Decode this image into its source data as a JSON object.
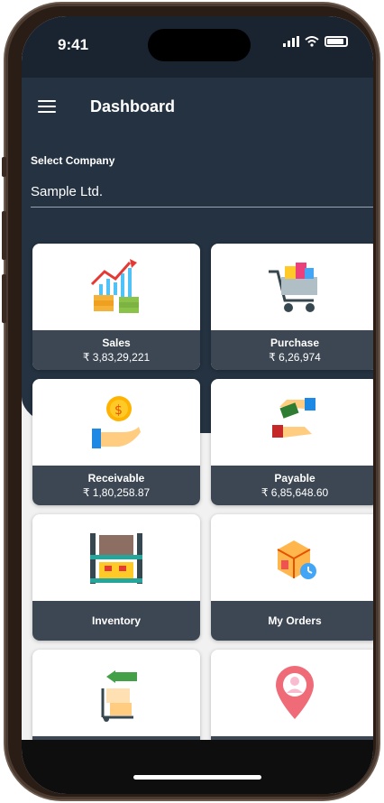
{
  "status": {
    "time": "9:41"
  },
  "appbar": {
    "title": "Dashboard"
  },
  "company": {
    "label": "Select Company",
    "value": "Sample Ltd."
  },
  "tiles": [
    {
      "name": "Sales",
      "amount": "₹ 3,83,29,221",
      "icon": "sales-chart-icon"
    },
    {
      "name": "Purchase",
      "amount": "₹ 6,26,974",
      "icon": "shopping-cart-icon"
    },
    {
      "name": "Receivable",
      "amount": "₹ 1,80,258.87",
      "icon": "coin-hand-icon"
    },
    {
      "name": "Payable",
      "amount": "₹ 6,85,648.60",
      "icon": "money-handover-icon"
    },
    {
      "name": "Inventory",
      "amount": "",
      "icon": "warehouse-shelf-icon"
    },
    {
      "name": "My Orders",
      "amount": "",
      "icon": "package-clock-icon"
    },
    {
      "name": "",
      "amount": "",
      "icon": "hand-truck-icon"
    },
    {
      "name": "",
      "amount": "",
      "icon": "location-pin-icon"
    }
  ],
  "colors": {
    "primary": "#243241",
    "card_footer": "#3d4753",
    "background": "#f1f1f1"
  }
}
